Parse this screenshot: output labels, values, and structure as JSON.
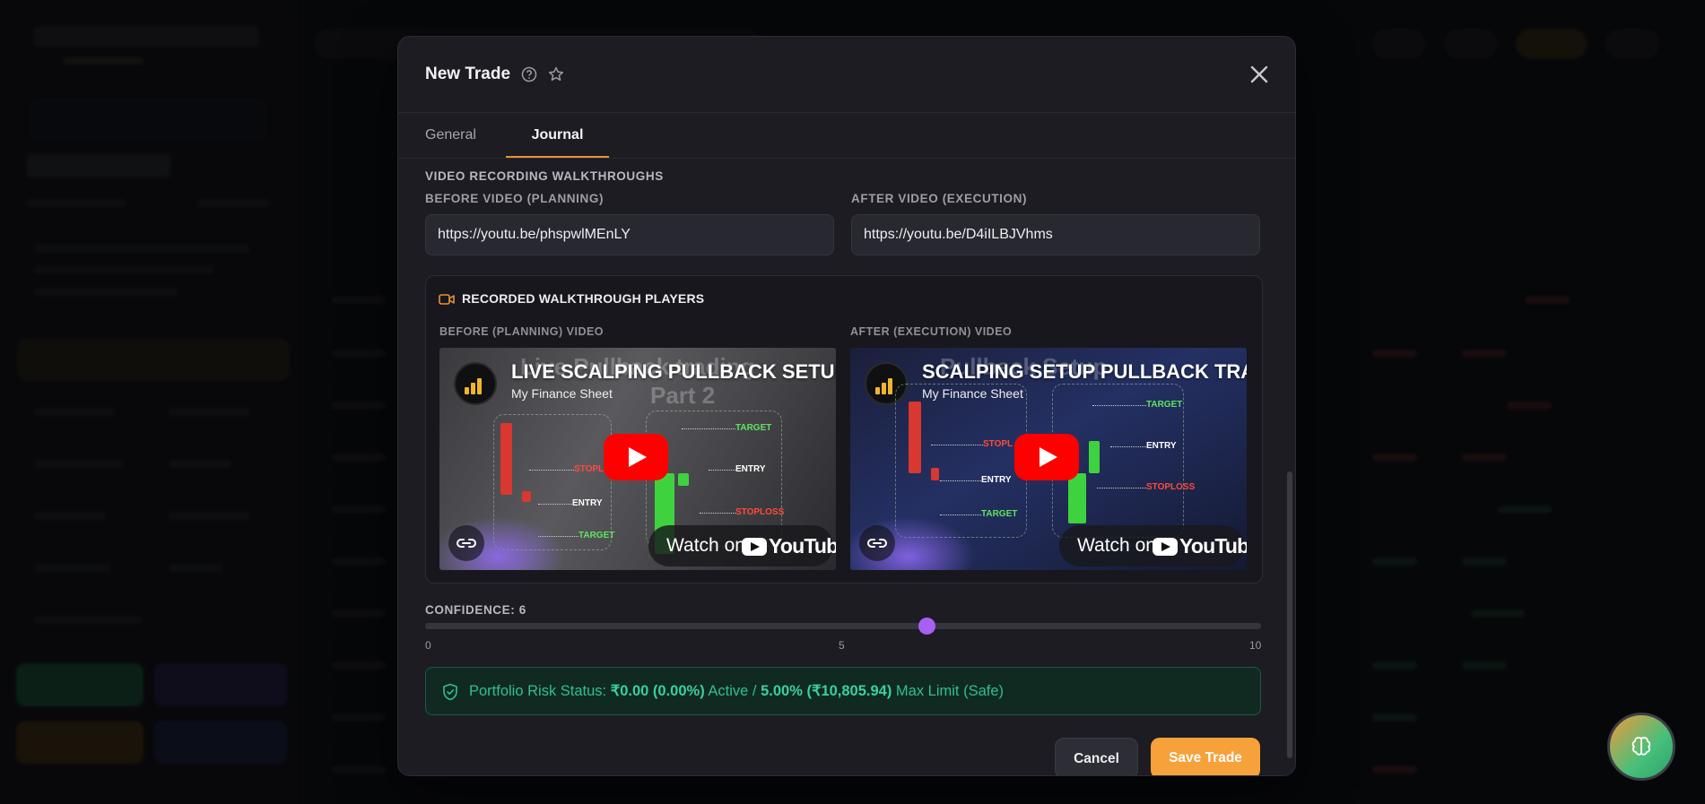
{
  "modal": {
    "title": "New Trade",
    "tabs": [
      {
        "label": "General",
        "active": false
      },
      {
        "label": "Journal",
        "active": true
      }
    ],
    "section_title": "VIDEO RECORDING WALKTHROUGHS",
    "before_label": "BEFORE VIDEO (PLANNING)",
    "after_label": "AFTER VIDEO (EXECUTION)",
    "before_url": "https://youtu.be/phspwlMEnLY",
    "after_url": "https://youtu.be/D4iILBJVhms",
    "players": {
      "title": "RECORDED WALKTHROUGH PLAYERS",
      "before_player_label": "BEFORE (PLANNING) VIDEO",
      "after_player_label": "AFTER (EXECUTION) VIDEO",
      "videos": [
        {
          "title": "LIVE SCALPING PULLBACK SETUP",
          "channel": "My Finance Sheet",
          "thumb_title": "Live Pullback trading",
          "thumb_part": "Part 2",
          "labels": {
            "target": "TARGET",
            "stoploss": "STOPLOSS",
            "entry": "ENTRY",
            "stop_short": "STOPL"
          },
          "watch_on": "Watch on",
          "youtube": "YouTube"
        },
        {
          "title": "SCALPING SETUP PULLBACK TRA",
          "channel": "My Finance Sheet",
          "thumb_title": "Pullback Setup",
          "labels": {
            "target": "TARGET",
            "stoploss": "STOPLOSS",
            "entry": "ENTRY",
            "stop_short": "STOPL"
          },
          "watch_on": "Watch on",
          "youtube": "YouTube"
        }
      ]
    },
    "confidence": {
      "label": "CONFIDENCE: 6",
      "value": 6,
      "min": 0,
      "max": 10,
      "ticks": [
        "0",
        "5",
        "10"
      ]
    },
    "risk_status": {
      "prefix": "Portfolio Risk Status: ",
      "current": "₹0.00 (0.00%)",
      "middle": " Active / ",
      "limit": "5.00% (₹10,805.94)",
      "suffix": " Max Limit (Safe)"
    },
    "buttons": {
      "cancel": "Cancel",
      "save": "Save Trade"
    }
  },
  "colors": {
    "accent_orange": "#f7a13b",
    "slider_purple": "#a760f2",
    "risk_green": "#30c08a",
    "youtube_red": "#ff0000"
  }
}
